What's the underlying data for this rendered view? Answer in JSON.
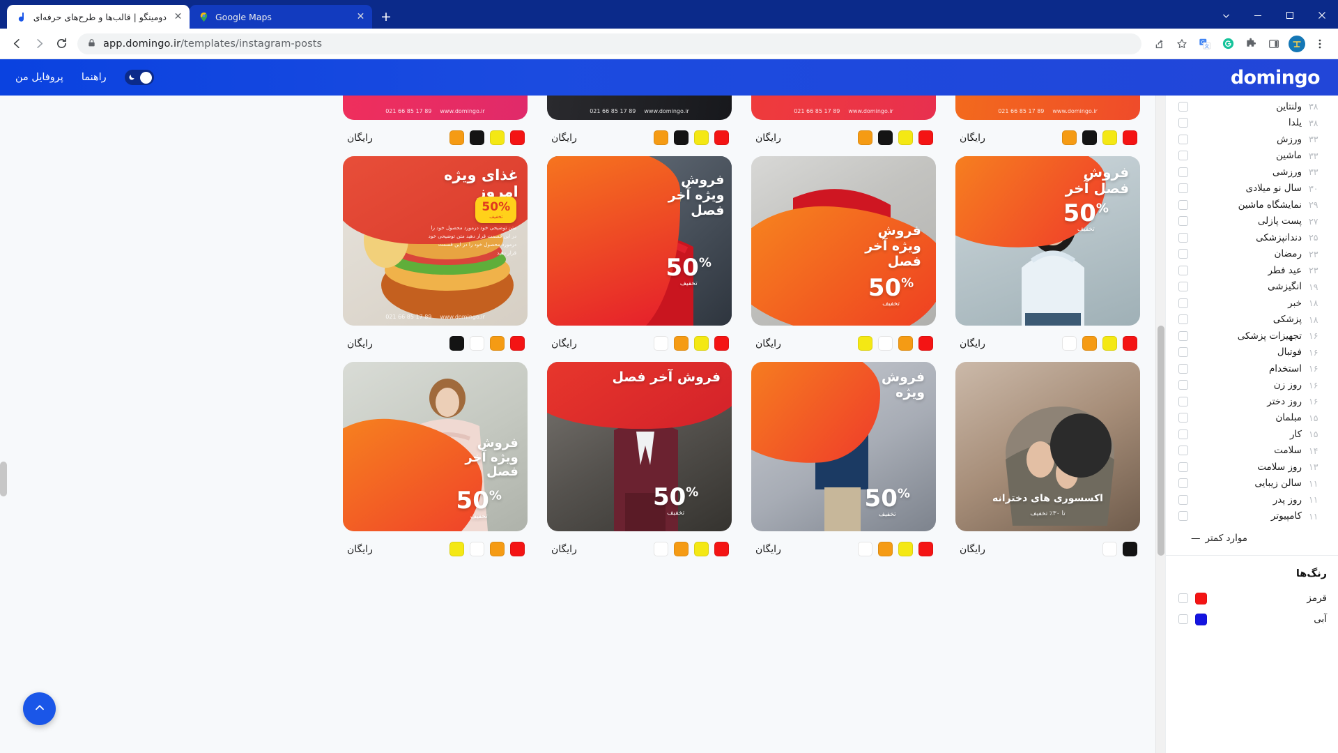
{
  "browser": {
    "tabs": [
      {
        "title": "دومینگو | قالب‌ها و طرح‌های حرفه‌ای",
        "favicon": "domingo-favicon",
        "active": true
      },
      {
        "title": "Google Maps",
        "favicon": "google-maps-favicon",
        "active": false
      }
    ],
    "new_tab_label": "+",
    "nav": {
      "back": "←",
      "forward": "→",
      "reload": "⟳"
    },
    "omnibox": {
      "lock_icon": "lock-icon",
      "host": "app.domingo.ir",
      "path": "/templates/instagram-posts"
    },
    "toolbar_icons": [
      "share-icon",
      "bookmark-star-icon",
      "google-translate-icon",
      "grammarly-icon",
      "extensions-puzzle-icon",
      "side-panel-icon",
      "profile-avatar-icon",
      "chrome-menu-icon"
    ],
    "window_controls": {
      "minimize": "—",
      "maximize": "▢",
      "close": "✕",
      "chevron": "⌄"
    }
  },
  "app_header": {
    "brand": "domingo",
    "profile_label": "پروفایل من",
    "help_label": "راهنما",
    "theme_toggle": {
      "icon": "moon-icon",
      "state": "dark-mode-toggle"
    }
  },
  "sidebar": {
    "tags": [
      {
        "label": "ولنتاین",
        "count": "۳۸"
      },
      {
        "label": "یلدا",
        "count": "۳۸"
      },
      {
        "label": "ورزش",
        "count": "۳۳"
      },
      {
        "label": "ماشین",
        "count": "۳۳"
      },
      {
        "label": "ورزشی",
        "count": "۳۳"
      },
      {
        "label": "سال نو میلادی",
        "count": "۳۰"
      },
      {
        "label": "نمایشگاه ماشین",
        "count": "۲۹"
      },
      {
        "label": "پست پازلی",
        "count": "۲۷"
      },
      {
        "label": "دندانپزشکی",
        "count": "۲۵"
      },
      {
        "label": "رمضان",
        "count": "۲۳"
      },
      {
        "label": "عید فطر",
        "count": "۲۳"
      },
      {
        "label": "انگیزشی",
        "count": "۱۹"
      },
      {
        "label": "خبر",
        "count": "۱۸"
      },
      {
        "label": "پزشکی",
        "count": "۱۸"
      },
      {
        "label": "تجهیزات پزشکی",
        "count": "۱۶"
      },
      {
        "label": "فوتبال",
        "count": "۱۶"
      },
      {
        "label": "استخدام",
        "count": "۱۶"
      },
      {
        "label": "روز زن",
        "count": "۱۶"
      },
      {
        "label": "روز دختر",
        "count": "۱۶"
      },
      {
        "label": "مبلمان",
        "count": "۱۵"
      },
      {
        "label": "کار",
        "count": "۱۵"
      },
      {
        "label": "سلامت",
        "count": "۱۴"
      },
      {
        "label": "روز سلامت",
        "count": "۱۳"
      },
      {
        "label": "سالن زیبایی",
        "count": "۱۱"
      },
      {
        "label": "روز پدر",
        "count": "۱۱"
      },
      {
        "label": "کامپیوتر",
        "count": "۱۱"
      }
    ],
    "less_link": "موارد کمتر",
    "less_dash": "—",
    "colors_heading": "رنگ‌ها",
    "colors": [
      {
        "label": "قرمز",
        "hex": "#f41414"
      },
      {
        "label": "آبی",
        "hex": "#1414e0"
      }
    ]
  },
  "gallery": {
    "price_label": "رایگان",
    "rows": [
      {
        "cards": [
          {
            "id": "card-r0-c0",
            "clipped": true,
            "swatches": [
              "#f59b14",
              "#141414",
              "#f4e814",
              "#f41414"
            ]
          },
          {
            "id": "card-r0-c1",
            "clipped": true,
            "swatches": [
              "#f59b14",
              "#141414",
              "#f4e814",
              "#f41414"
            ]
          },
          {
            "id": "card-r0-c2",
            "clipped": true,
            "swatches": [
              "#f59b14",
              "#141414",
              "#f4e814",
              "#f41414"
            ]
          },
          {
            "id": "card-r0-c3",
            "clipped": true,
            "swatches": [
              "#f59b14",
              "#141414",
              "#f4e814",
              "#f41414"
            ]
          }
        ]
      },
      {
        "cards": [
          {
            "id": "card-r1-c0",
            "swatches": [
              "#ffffff",
              "#f59b14",
              "#f4e814",
              "#f41414"
            ],
            "headline": "فروش\nفصل آخر",
            "discount": "50",
            "discount_sub": "تخفیف"
          },
          {
            "id": "card-r1-c1",
            "swatches": [
              "#f4e814",
              "#ffffff",
              "#f59b14",
              "#f41414"
            ],
            "headline": "فروش\nویژه آخر\nفصل",
            "discount": "50",
            "discount_sub": "تخفیف"
          },
          {
            "id": "card-r1-c2",
            "swatches": [
              "#ffffff",
              "#f59b14",
              "#f4e814",
              "#f41414"
            ],
            "headline": "فروش\nویژه آخر\nفصل",
            "discount": "50",
            "discount_sub": "تخفیف"
          },
          {
            "id": "card-r1-c3",
            "swatches": [
              "#141414",
              "#ffffff",
              "#f59b14",
              "#f41414"
            ],
            "headline": "غذای ویژه\nامروز",
            "badge": "50%",
            "badge_sub": "تخفیف"
          }
        ]
      },
      {
        "cards": [
          {
            "id": "card-r2-c0",
            "swatches": [
              "#ffffff",
              "#141414"
            ],
            "headline": "اکسسوری های دخترانه",
            "sub": "تا ۳۰٪ تخفیف"
          },
          {
            "id": "card-r2-c1",
            "swatches": [
              "#ffffff",
              "#f59b14",
              "#f4e814",
              "#f41414"
            ],
            "headline": "فروش\nویژه",
            "discount": "50",
            "discount_sub": "تخفیف"
          },
          {
            "id": "card-r2-c2",
            "swatches": [
              "#ffffff",
              "#f59b14",
              "#f4e814",
              "#f41414"
            ],
            "headline": "فروش آخر فصل",
            "discount": "50",
            "discount_sub": "تخفیف"
          },
          {
            "id": "card-r2-c3",
            "swatches": [
              "#f4e814",
              "#ffffff",
              "#f59b14",
              "#f41414"
            ],
            "headline": "فروش\nویژه آخر\nفصل",
            "discount": "50",
            "discount_sub": "تخفیف"
          }
        ]
      }
    ],
    "poster_body": "متن توضیحی خود درمورد محصول خود را در این قسمت قرار دهید متن توضیحی خود درمورد محصول خود را در این قسمت قرار دهید",
    "poster_site": "www.domingo.ir",
    "poster_phone": "021 66 85 17 89"
  },
  "fab": {
    "icon": "chevron-up-icon"
  }
}
